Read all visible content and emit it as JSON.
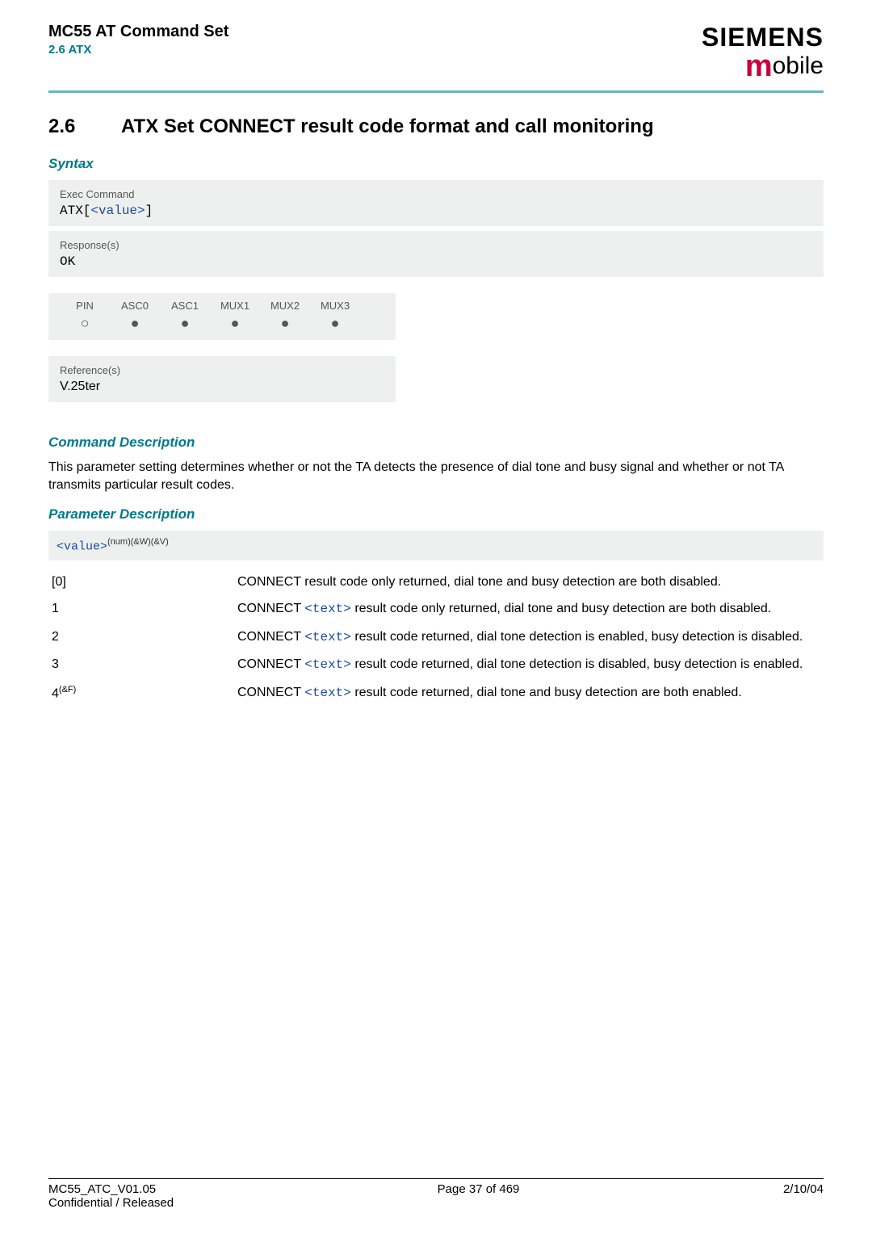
{
  "header": {
    "product": "MC55 AT Command Set",
    "section_ref": "2.6 ATX",
    "brand": "SIEMENS",
    "brand_sub_m": "m",
    "brand_sub_rest": "obile"
  },
  "section": {
    "number": "2.6",
    "title": "ATX   Set CONNECT result code format and call monitoring"
  },
  "syntax": {
    "heading": "Syntax",
    "exec_label": "Exec Command",
    "exec_pre": "ATX[",
    "exec_param": "<value>",
    "exec_post": "]",
    "response_label": "Response(s)",
    "response_value": "OK"
  },
  "pin_table": {
    "headers": [
      "PIN",
      "ASC0",
      "ASC1",
      "MUX1",
      "MUX2",
      "MUX3"
    ],
    "dots": [
      "○",
      "●",
      "●",
      "●",
      "●",
      "●"
    ]
  },
  "reference": {
    "label": "Reference(s)",
    "value": "V.25ter"
  },
  "command_desc": {
    "heading": "Command Description",
    "text": "This parameter setting determines whether or not the TA detects the presence of dial tone and busy signal and whether or not TA transmits particular result codes."
  },
  "param_desc": {
    "heading": "Parameter Description",
    "param_code": "<value>",
    "param_sup": "(num)(&W)(&V)",
    "rows": [
      {
        "key": "[0]",
        "sup": "",
        "pre": "CONNECT result code only returned, dial tone and busy detection are both disabled.",
        "link": "",
        "post": ""
      },
      {
        "key": "1",
        "sup": "",
        "pre": "CONNECT ",
        "link": "<text>",
        "post": " result code only returned, dial tone and busy detection are both disabled."
      },
      {
        "key": "2",
        "sup": "",
        "pre": "CONNECT ",
        "link": "<text>",
        "post": " result code returned, dial tone detection is enabled, busy detection is disabled."
      },
      {
        "key": "3",
        "sup": "",
        "pre": "CONNECT ",
        "link": "<text>",
        "post": " result code returned, dial tone detection is disabled, busy detection is enabled."
      },
      {
        "key": "4",
        "sup": "(&F)",
        "pre": "CONNECT ",
        "link": "<text>",
        "post": " result code returned, dial tone and busy detection are both enabled."
      }
    ]
  },
  "footer": {
    "left1": "MC55_ATC_V01.05",
    "left2": "Confidential / Released",
    "center": "Page 37 of 469",
    "right": "2/10/04"
  }
}
